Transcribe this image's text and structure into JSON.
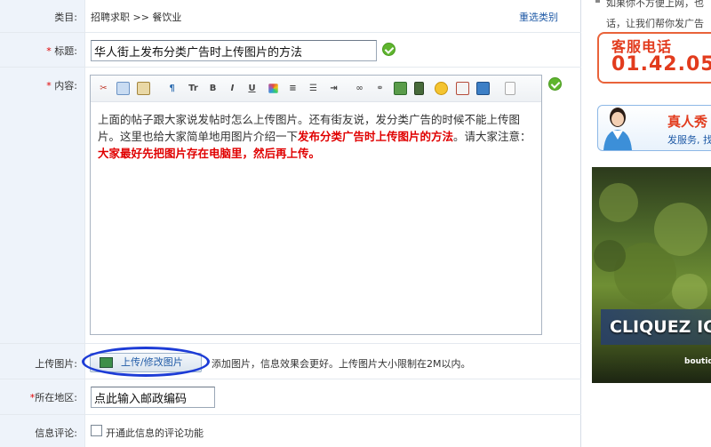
{
  "form": {
    "category": {
      "label": "类目:",
      "value": "招聘求职 >> 餐饮业",
      "reselect_link": "重选类别"
    },
    "title": {
      "required_mark": "*",
      "label": " 标题:",
      "value": "华人街上发布分类广告时上传图片的方法"
    },
    "content": {
      "required_mark": "*",
      "label": " 内容:",
      "toolbar": [
        "cut-icon",
        "copy-icon",
        "paste-icon",
        "format-icon",
        "font-size-icon",
        "bold-icon",
        "italic-icon",
        "underline-icon",
        "color-icon",
        "align-icon",
        "list-icon",
        "indent-icon",
        "link-icon",
        "unlink-icon",
        "image-icon",
        "media-icon",
        "emoticon-icon",
        "edit-icon",
        "save-icon",
        "document-icon"
      ],
      "toolbar_letters": {
        "font_size": "Tr",
        "bold": "B",
        "italic": "I",
        "underline": "U"
      },
      "body_plain_1": "上面的帖子跟大家说发帖时怎么上传图片。还有街友说，发分类广告的时候不能上传图片。这里也给大家简单地用图片介绍一下",
      "body_highlight_1": "发布分类广告时上传图片的方法",
      "body_plain_2": "。请大家注意：",
      "body_highlight_2": "大家最好先把图片存在电脑里，然后再上传。"
    },
    "upload": {
      "label": "上传图片:",
      "button_label": "上传/修改图片",
      "hint": "添加图片，信息效果会更好。上传图片大小限制在2M以内。"
    },
    "region": {
      "required_mark": "*",
      "label": "所在地区:",
      "value": "点此输入邮政编码"
    },
    "comment": {
      "label": "信息评论:",
      "checkbox_label": "开通此信息的评论功能",
      "checked": false
    }
  },
  "sidebar": {
    "note_line1": "如果你不方便上网，也",
    "note_line2": "话，让我们帮你发广告",
    "hotline_label": "客服电话",
    "hotline_number": "01.42.05",
    "service_title": "真人秀",
    "service_sub": "发服务, 找",
    "ad_cta": "CLIQUEZ ICI",
    "ad_brand": "boutiq"
  },
  "colors": {
    "required": "#e00000",
    "link": "#1f5aa6",
    "label_bg": "#eef3fa",
    "highlight_ring": "#1d3cd6",
    "hotline": "#e23b1d",
    "valid_check": "#5fb52e"
  }
}
